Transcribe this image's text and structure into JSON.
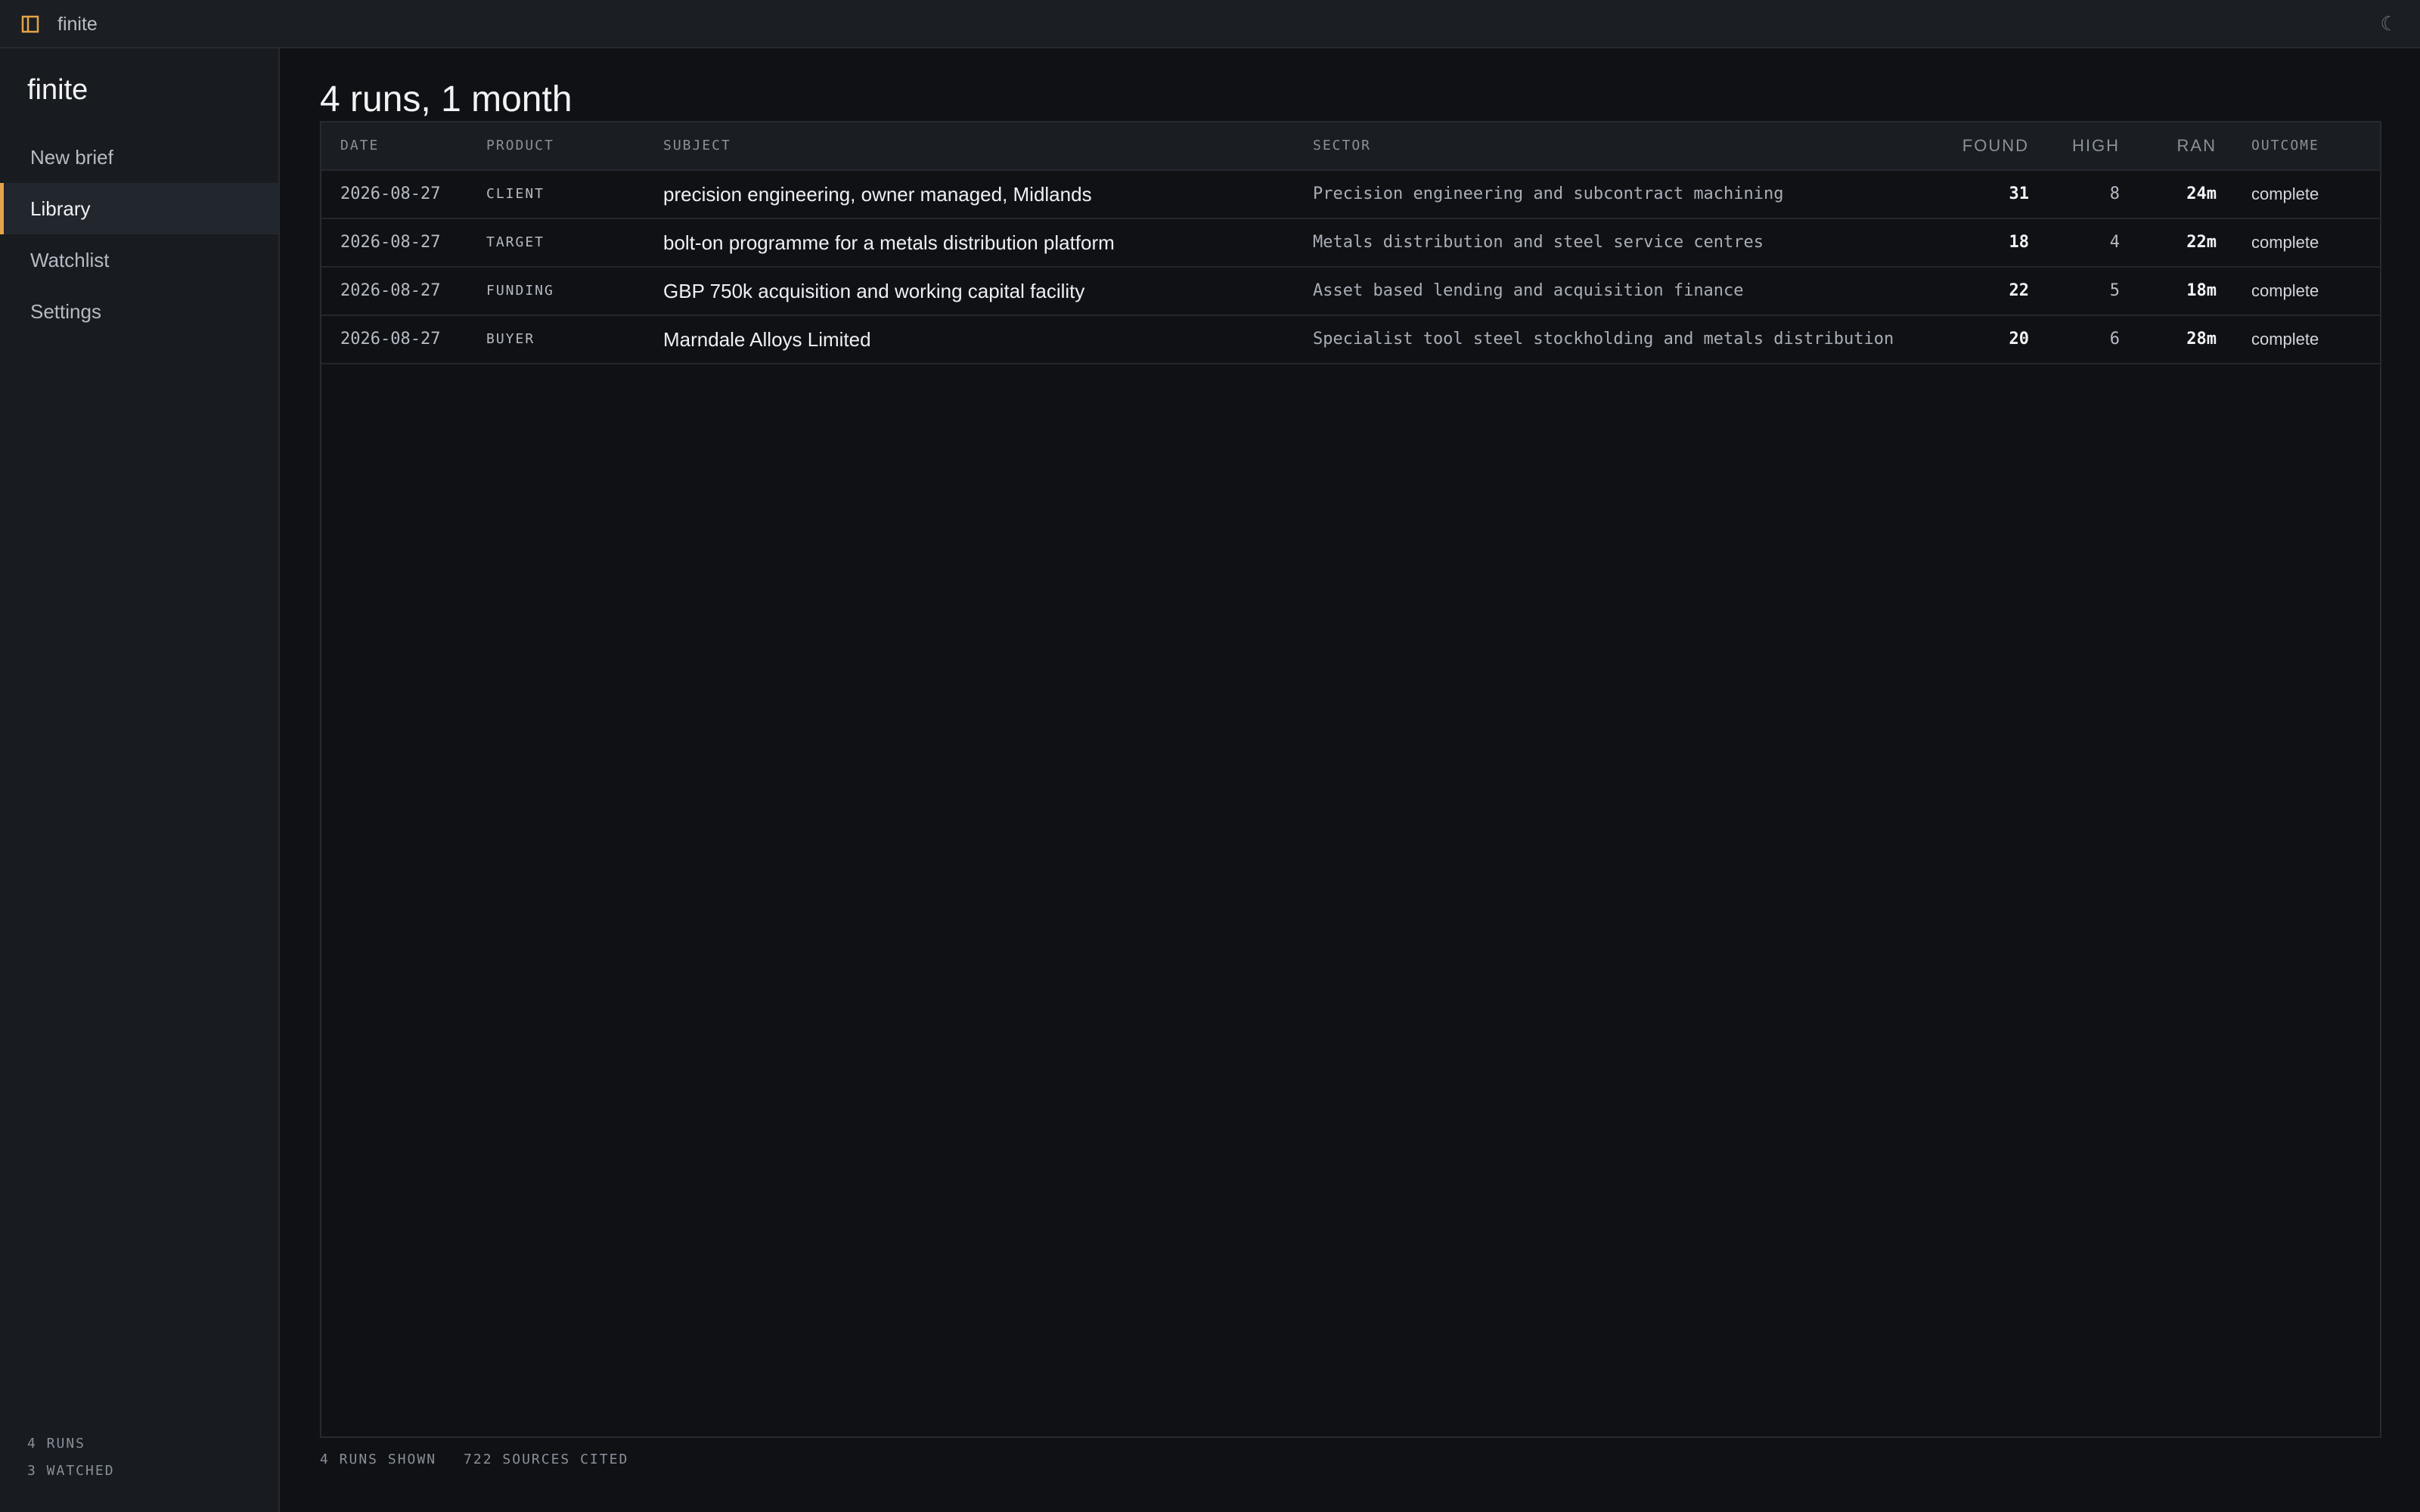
{
  "window": {
    "title": "finite",
    "icon": "book-icon",
    "theme_toggle_icon": "moon-icon"
  },
  "colors": {
    "accent": "#e3a448",
    "background": "#0f1115",
    "sidebar": "#181b20"
  },
  "sidebar": {
    "brand": "finite",
    "items": [
      {
        "label": "New brief",
        "active": false
      },
      {
        "label": "Library",
        "active": true
      },
      {
        "label": "Watchlist",
        "active": false
      },
      {
        "label": "Settings",
        "active": false
      }
    ],
    "stats": {
      "runs": "4 RUNS",
      "watched": "3 WATCHED"
    }
  },
  "main": {
    "title": "4 runs, 1 month",
    "table": {
      "headers": {
        "date": "DATE",
        "product": "PRODUCT",
        "subject": "SUBJECT",
        "sector": "SECTOR",
        "found": "FOUND",
        "high": "HIGH",
        "ran": "RAN",
        "outcome": "OUTCOME"
      },
      "rows": [
        {
          "date": "2026-08-27",
          "product": "CLIENT",
          "subject": "precision engineering, owner managed, Midlands",
          "sector": "Precision engineering and subcontract machining",
          "found": "31",
          "high": "8",
          "ran": "24m",
          "outcome": "complete"
        },
        {
          "date": "2026-08-27",
          "product": "TARGET",
          "subject": "bolt-on programme for a metals distribution platform",
          "sector": "Metals distribution and steel service centres",
          "found": "18",
          "high": "4",
          "ran": "22m",
          "outcome": "complete"
        },
        {
          "date": "2026-08-27",
          "product": "FUNDING",
          "subject": "GBP 750k acquisition and working capital facility",
          "sector": "Asset based lending and acquisition finance",
          "found": "22",
          "high": "5",
          "ran": "18m",
          "outcome": "complete"
        },
        {
          "date": "2026-08-27",
          "product": "BUYER",
          "subject": "Marndale Alloys Limited",
          "sector": "Specialist tool steel stockholding and metals distribution",
          "found": "20",
          "high": "6",
          "ran": "28m",
          "outcome": "complete"
        }
      ]
    },
    "footer": {
      "runs_shown": "4 RUNS SHOWN",
      "sources_cited": "722 SOURCES CITED"
    }
  }
}
